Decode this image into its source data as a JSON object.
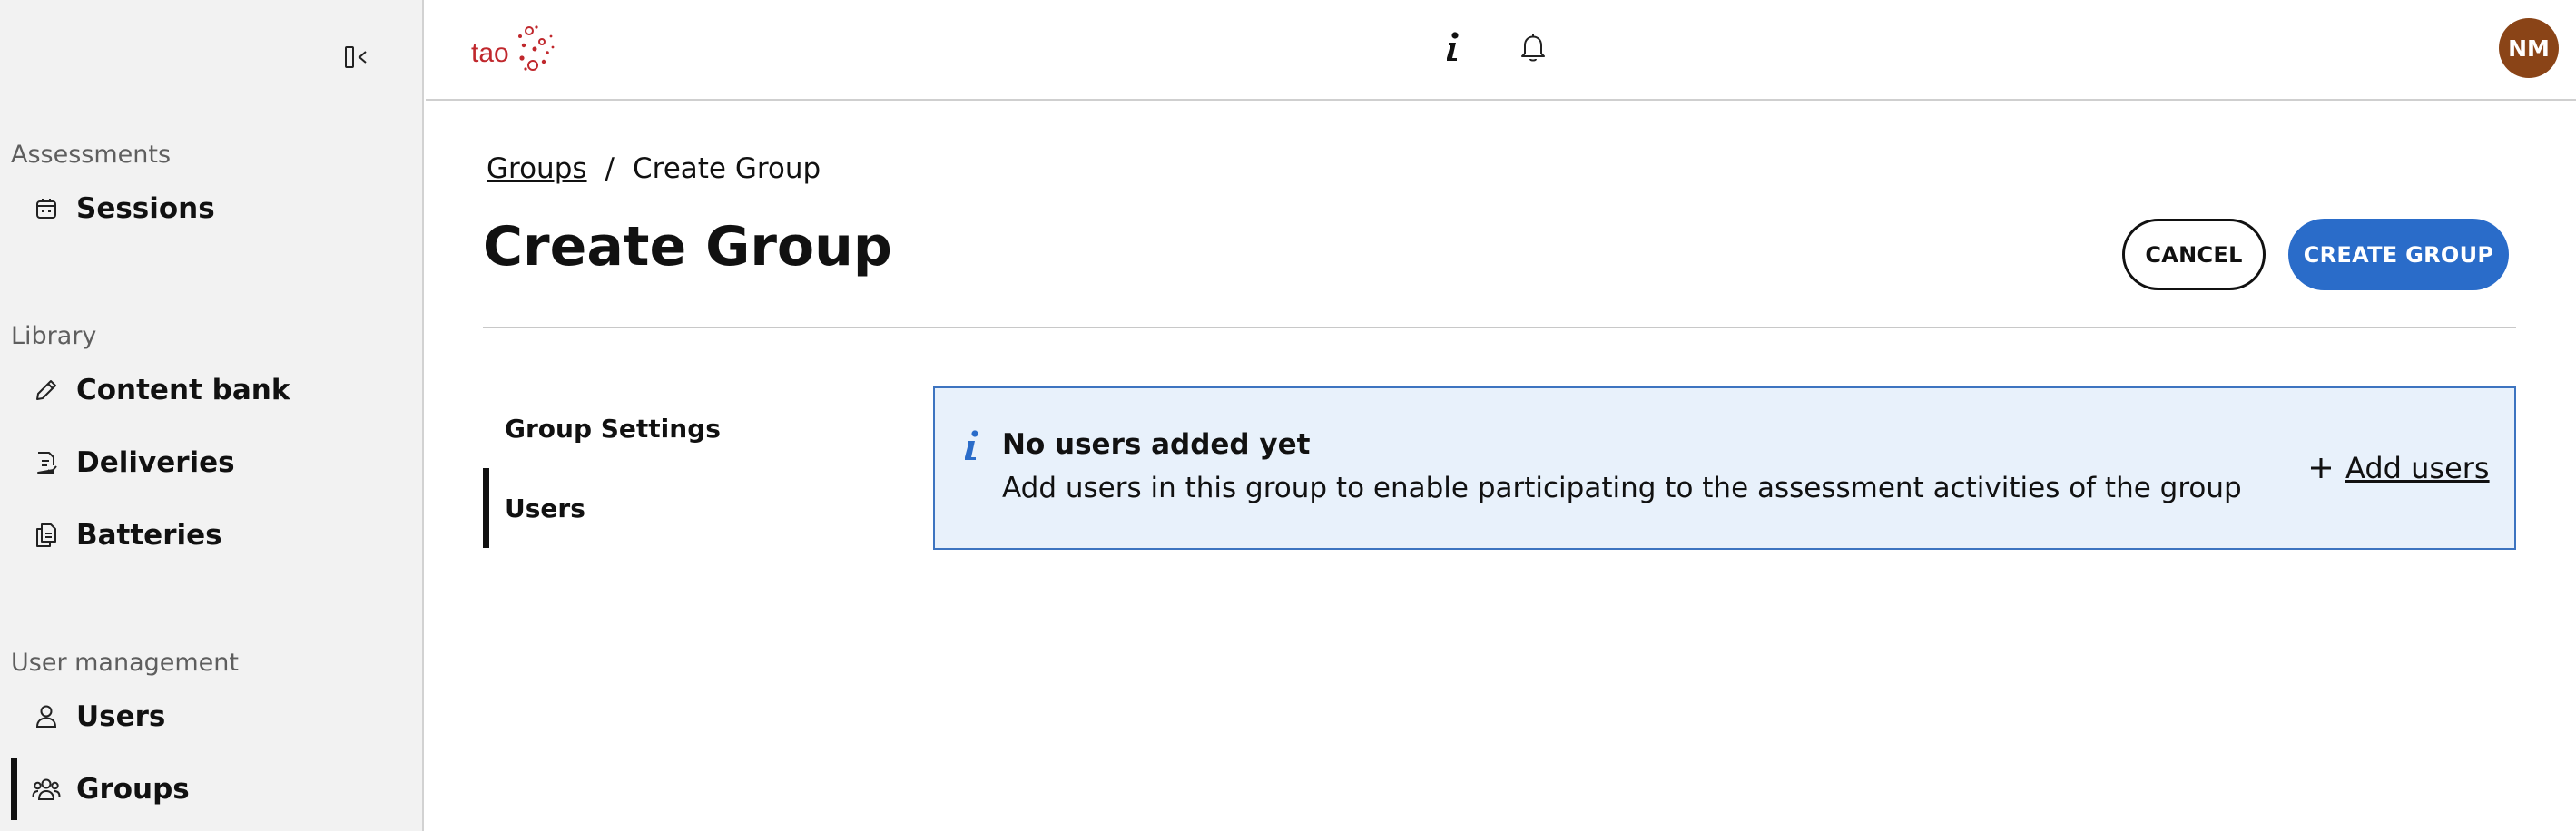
{
  "sidebar": {
    "sections": [
      {
        "label": "Assessments",
        "items": [
          {
            "label": "Sessions",
            "icon": "calendar-icon"
          }
        ]
      },
      {
        "label": "Library",
        "items": [
          {
            "label": "Content bank",
            "icon": "pencil-icon"
          },
          {
            "label": "Deliveries",
            "icon": "document-check-icon"
          },
          {
            "label": "Batteries",
            "icon": "documents-icon"
          }
        ]
      },
      {
        "label": "User management",
        "items": [
          {
            "label": "Users",
            "icon": "user-icon"
          },
          {
            "label": "Groups",
            "icon": "users-group-icon",
            "active": true
          }
        ]
      }
    ],
    "collapse_icon": "sidebar-collapse-icon"
  },
  "header": {
    "logo_text": "tao",
    "icons": [
      "info-icon",
      "bell-icon"
    ],
    "avatar_initials": "NM"
  },
  "breadcrumb": {
    "parent": "Groups",
    "separator": "/",
    "current": "Create Group"
  },
  "page": {
    "title": "Create Group",
    "cancel_label": "CANCEL",
    "create_label": "CREATE GROUP"
  },
  "subnav": [
    {
      "label": "Group Settings"
    },
    {
      "label": "Users",
      "active": true
    }
  ],
  "info_panel": {
    "title": "No users added yet",
    "description": "Add users in this group to enable participating to the assessment activities of the group",
    "action_label": "Add users"
  },
  "colors": {
    "accent": "#2a6cc9",
    "info_bg": "#e8f1fb",
    "info_border": "#3d74c0",
    "avatar": "#8a4417",
    "logo": "#c0282d",
    "sidebar_bg": "#f2f2f2"
  }
}
